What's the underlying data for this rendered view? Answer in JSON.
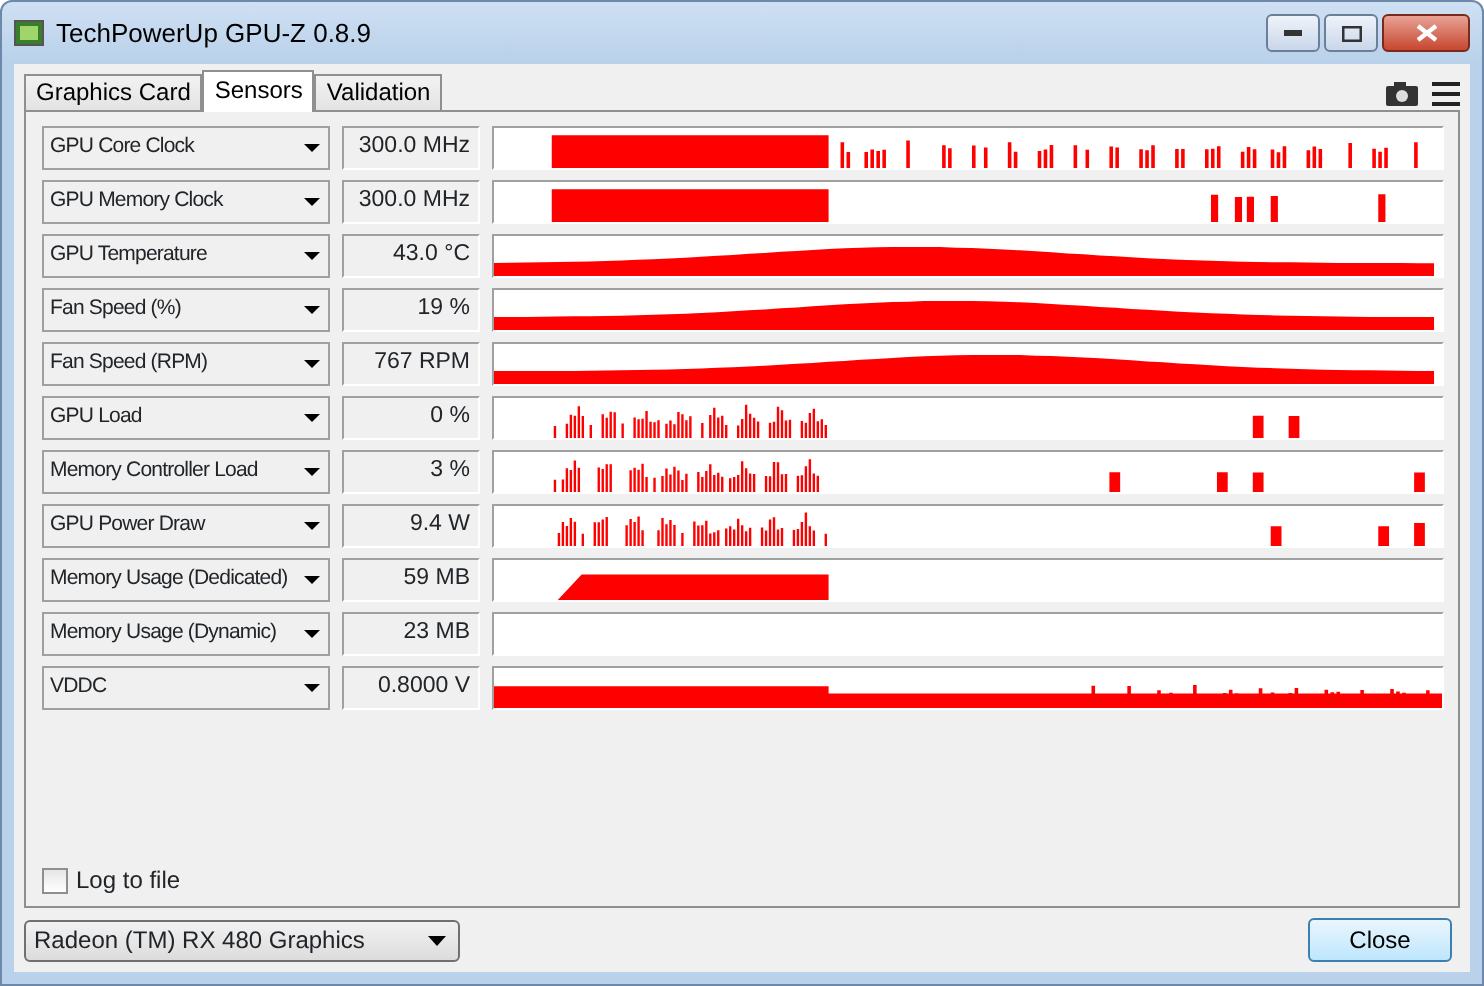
{
  "window": {
    "title": "TechPowerUp GPU-Z 0.8.9"
  },
  "tabs": [
    {
      "label": "Graphics Card",
      "selected": false
    },
    {
      "label": "Sensors",
      "selected": true
    },
    {
      "label": "Validation",
      "selected": false
    }
  ],
  "sensors": [
    {
      "name": "GPU Core Clock",
      "reading": "300.0 MHz",
      "kind": "plateau"
    },
    {
      "name": "GPU Memory Clock",
      "reading": "300.0 MHz",
      "kind": "block"
    },
    {
      "name": "GPU Temperature",
      "reading": "43.0 °C",
      "kind": "hump"
    },
    {
      "name": "Fan Speed (%)",
      "reading": "19 %",
      "kind": "hump"
    },
    {
      "name": "Fan Speed (RPM)",
      "reading": "767 RPM",
      "kind": "hump"
    },
    {
      "name": "GPU Load",
      "reading": "0 %",
      "kind": "spikes"
    },
    {
      "name": "Memory Controller Load",
      "reading": "3 %",
      "kind": "spikes"
    },
    {
      "name": "GPU Power Draw",
      "reading": "9.4 W",
      "kind": "spikes"
    },
    {
      "name": "Memory Usage (Dedicated)",
      "reading": "59 MB",
      "kind": "ramp"
    },
    {
      "name": "Memory Usage (Dynamic)",
      "reading": "23 MB",
      "kind": "flat"
    },
    {
      "name": "VDDC",
      "reading": "0.8000 V",
      "kind": "band"
    }
  ],
  "log_to_file": {
    "label": "Log to file",
    "checked": false
  },
  "gpu_select": {
    "value": "Radeon (TM) RX 480 Graphics"
  },
  "close_button": {
    "label": "Close"
  }
}
